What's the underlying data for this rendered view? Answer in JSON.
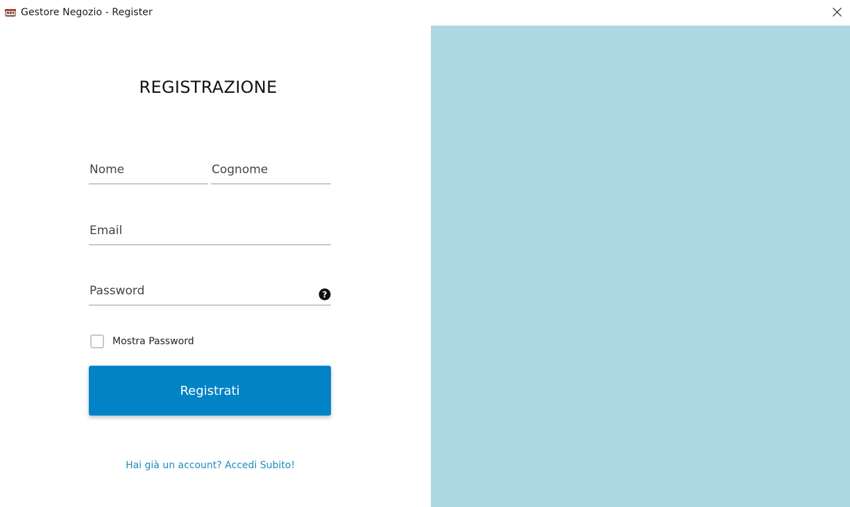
{
  "window": {
    "title": "Gestore Negozio - Register",
    "app_icon": "shop-register-icon",
    "close_icon": "close-icon"
  },
  "form": {
    "title": "REGISTRAZIONE",
    "nome_placeholder": "Nome",
    "cognome_placeholder": "Cognome",
    "email_placeholder": "Email",
    "password_placeholder": "Password",
    "help_icon": "question-circle-icon",
    "show_password_label": "Mostra Password",
    "show_password_checked": false,
    "submit_label": "Registrati",
    "login_link": "Hai già un account? Accedi Subito!"
  },
  "colors": {
    "side_panel": "#add8e4",
    "button": "#0283c5",
    "link": "#1b8ac0"
  }
}
